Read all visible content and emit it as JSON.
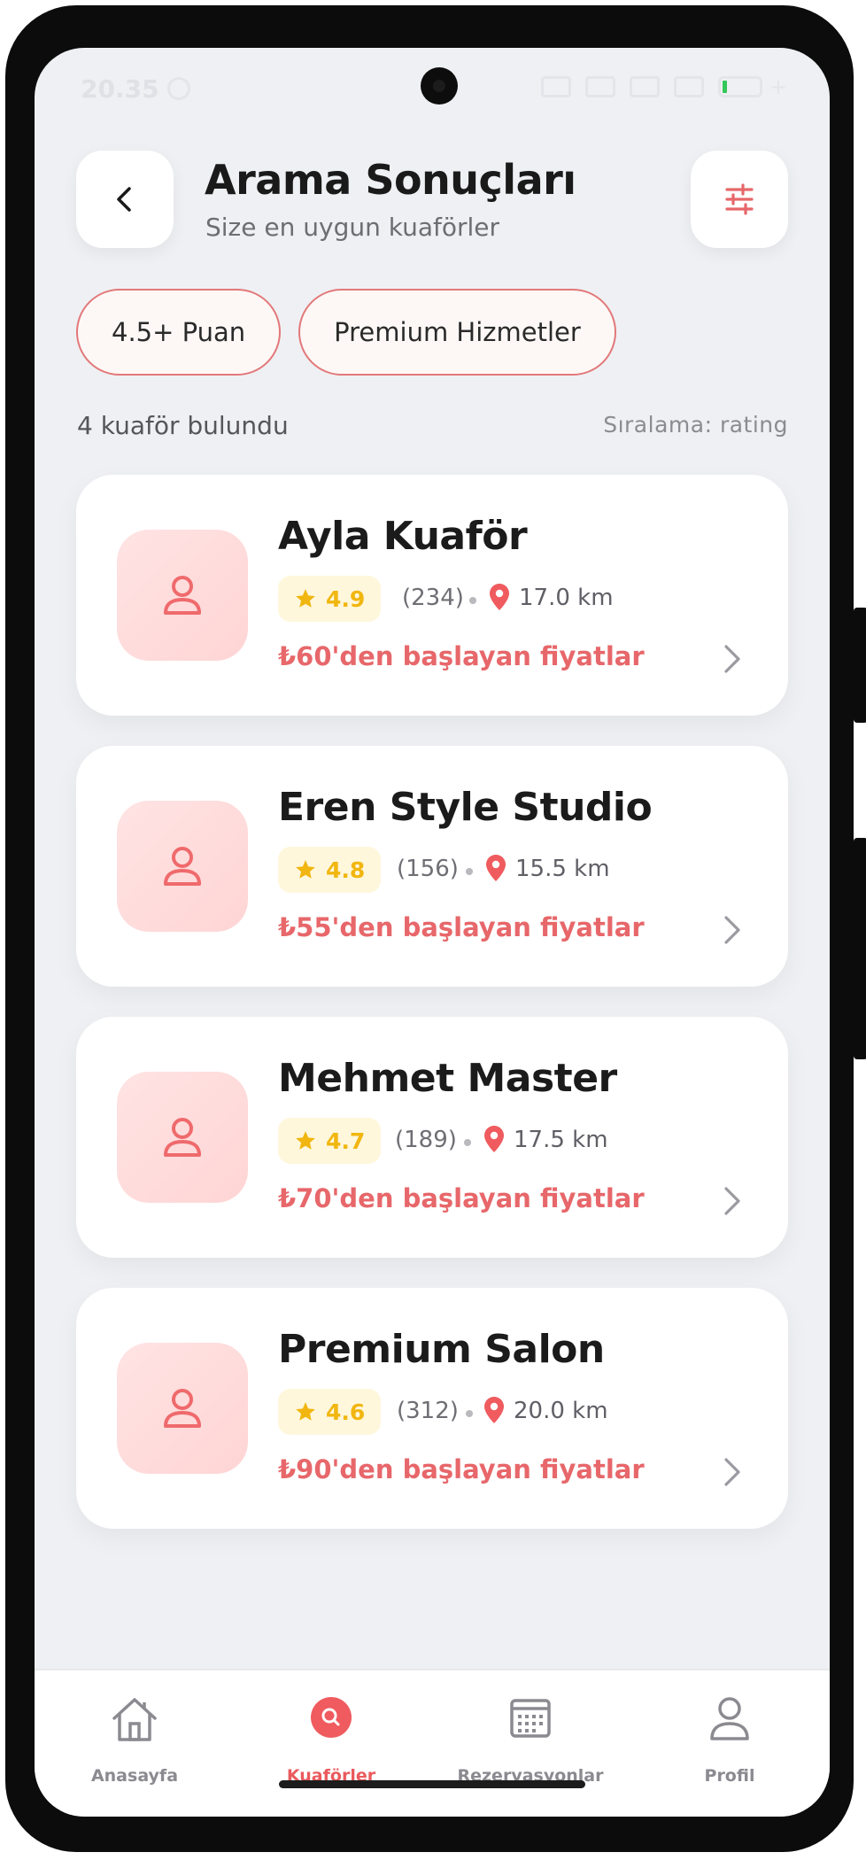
{
  "status_bar": {
    "time": "20.35"
  },
  "header": {
    "title": "Arama Sonuçları",
    "subtitle": "Size en uygun kuaförler",
    "back_icon": "chevron-left-icon",
    "filter_icon": "sliders-icon"
  },
  "filters": {
    "chips": [
      {
        "label": "4.5+ Puan"
      },
      {
        "label": "Premium Hizmetler"
      }
    ]
  },
  "results": {
    "count_text": "4 kuaför bulundu",
    "sort_text": "Sıralama: rating"
  },
  "salons": [
    {
      "name": "Ayla Kuaför",
      "rating": "4.9",
      "reviews": "(234)",
      "distance": "17.0 km",
      "price_text": "₺60'den başlayan fiyatlar"
    },
    {
      "name": "Eren Style Studio",
      "rating": "4.8",
      "reviews": "(156)",
      "distance": "15.5 km",
      "price_text": "₺55'den başlayan fiyatlar"
    },
    {
      "name": "Mehmet Master",
      "rating": "4.7",
      "reviews": "(189)",
      "distance": "17.5 km",
      "price_text": "₺70'den başlayan fiyatlar"
    },
    {
      "name": "Premium Salon",
      "rating": "4.6",
      "reviews": "(312)",
      "distance": "20.0 km",
      "price_text": "₺90'den başlayan fiyatlar"
    }
  ],
  "bottom_nav": {
    "items": [
      {
        "label": "Anasayfa",
        "icon": "home-icon"
      },
      {
        "label": "Kuaförler",
        "icon": "search-icon",
        "active": true
      },
      {
        "label": "Rezervasyonlar",
        "icon": "calendar-icon"
      },
      {
        "label": "Profil",
        "icon": "user-icon"
      }
    ]
  },
  "colors": {
    "accent": "#e7676a",
    "rating_star": "#f1b60f",
    "background": "#eff0f3"
  }
}
